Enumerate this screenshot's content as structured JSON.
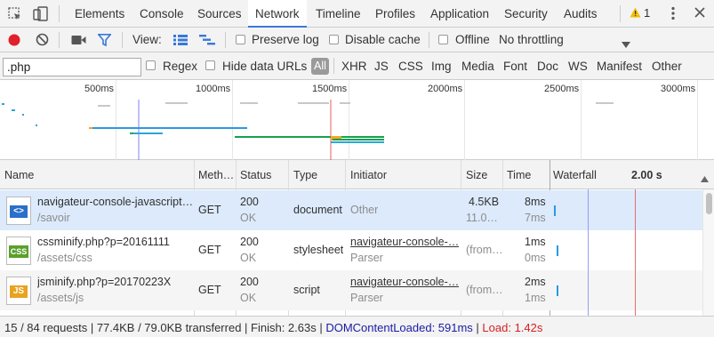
{
  "tabs": [
    "Elements",
    "Console",
    "Sources",
    "Network",
    "Timeline",
    "Profiles",
    "Application",
    "Security",
    "Audits"
  ],
  "warning_count": "1",
  "toolbar": {
    "view_label": "View:",
    "preserve_log": "Preserve log",
    "disable_cache": "Disable cache",
    "offline": "Offline",
    "throttling": "No throttling"
  },
  "filter": {
    "value": ".php",
    "regex": "Regex",
    "hide_data_urls": "Hide data URLs",
    "all": "All",
    "types": [
      "XHR",
      "JS",
      "CSS",
      "Img",
      "Media",
      "Font",
      "Doc",
      "WS",
      "Manifest",
      "Other"
    ]
  },
  "overview_ticks": [
    "500ms",
    "1000ms",
    "1500ms",
    "2000ms",
    "2500ms",
    "3000ms"
  ],
  "columns": {
    "name": "Name",
    "method": "Meth…",
    "status": "Status",
    "type": "Type",
    "initiator": "Initiator",
    "size": "Size",
    "time": "Time",
    "waterfall": "Waterfall",
    "waterfall_scale": "2.00 s"
  },
  "rows": [
    {
      "icon": "<>",
      "icon_name": "html-file-icon",
      "name": "navigateur-console-javascript…",
      "path": "/savoir",
      "method": "GET",
      "status": "200",
      "status_text": "OK",
      "type": "document",
      "initiator": "Other",
      "initiator_sub": "",
      "size": "4.5KB",
      "size_sub": "11.0…",
      "time": "8ms",
      "time_sub": "7ms"
    },
    {
      "icon": "CSS",
      "icon_name": "css-file-icon",
      "name": "cssminify.php?p=20161111",
      "path": "/assets/css",
      "method": "GET",
      "status": "200",
      "status_text": "OK",
      "type": "stylesheet",
      "initiator": "navigateur-console-…",
      "initiator_sub": "Parser",
      "size": "(from…",
      "size_sub": "",
      "time": "1ms",
      "time_sub": "0ms"
    },
    {
      "icon": "JS",
      "icon_name": "js-file-icon",
      "name": "jsminify.php?p=20170223X",
      "path": "/assets/js",
      "method": "GET",
      "status": "200",
      "status_text": "OK",
      "type": "script",
      "initiator": "navigateur-console-…",
      "initiator_sub": "Parser",
      "size": "(from…",
      "size_sub": "",
      "time": "2ms",
      "time_sub": "1ms"
    }
  ],
  "status_bar": {
    "summary": "15 / 84 requests | 77.4KB / 79.0KB transferred | Finish: 2.63s | ",
    "dcl": "DOMContentLoaded: 591ms",
    "sep": " | ",
    "load": "Load: 1.42s"
  },
  "colors": {
    "accent": "#3879d9",
    "record": "#e0202a",
    "dcl": "#1a1aa6",
    "load": "#d82020"
  }
}
